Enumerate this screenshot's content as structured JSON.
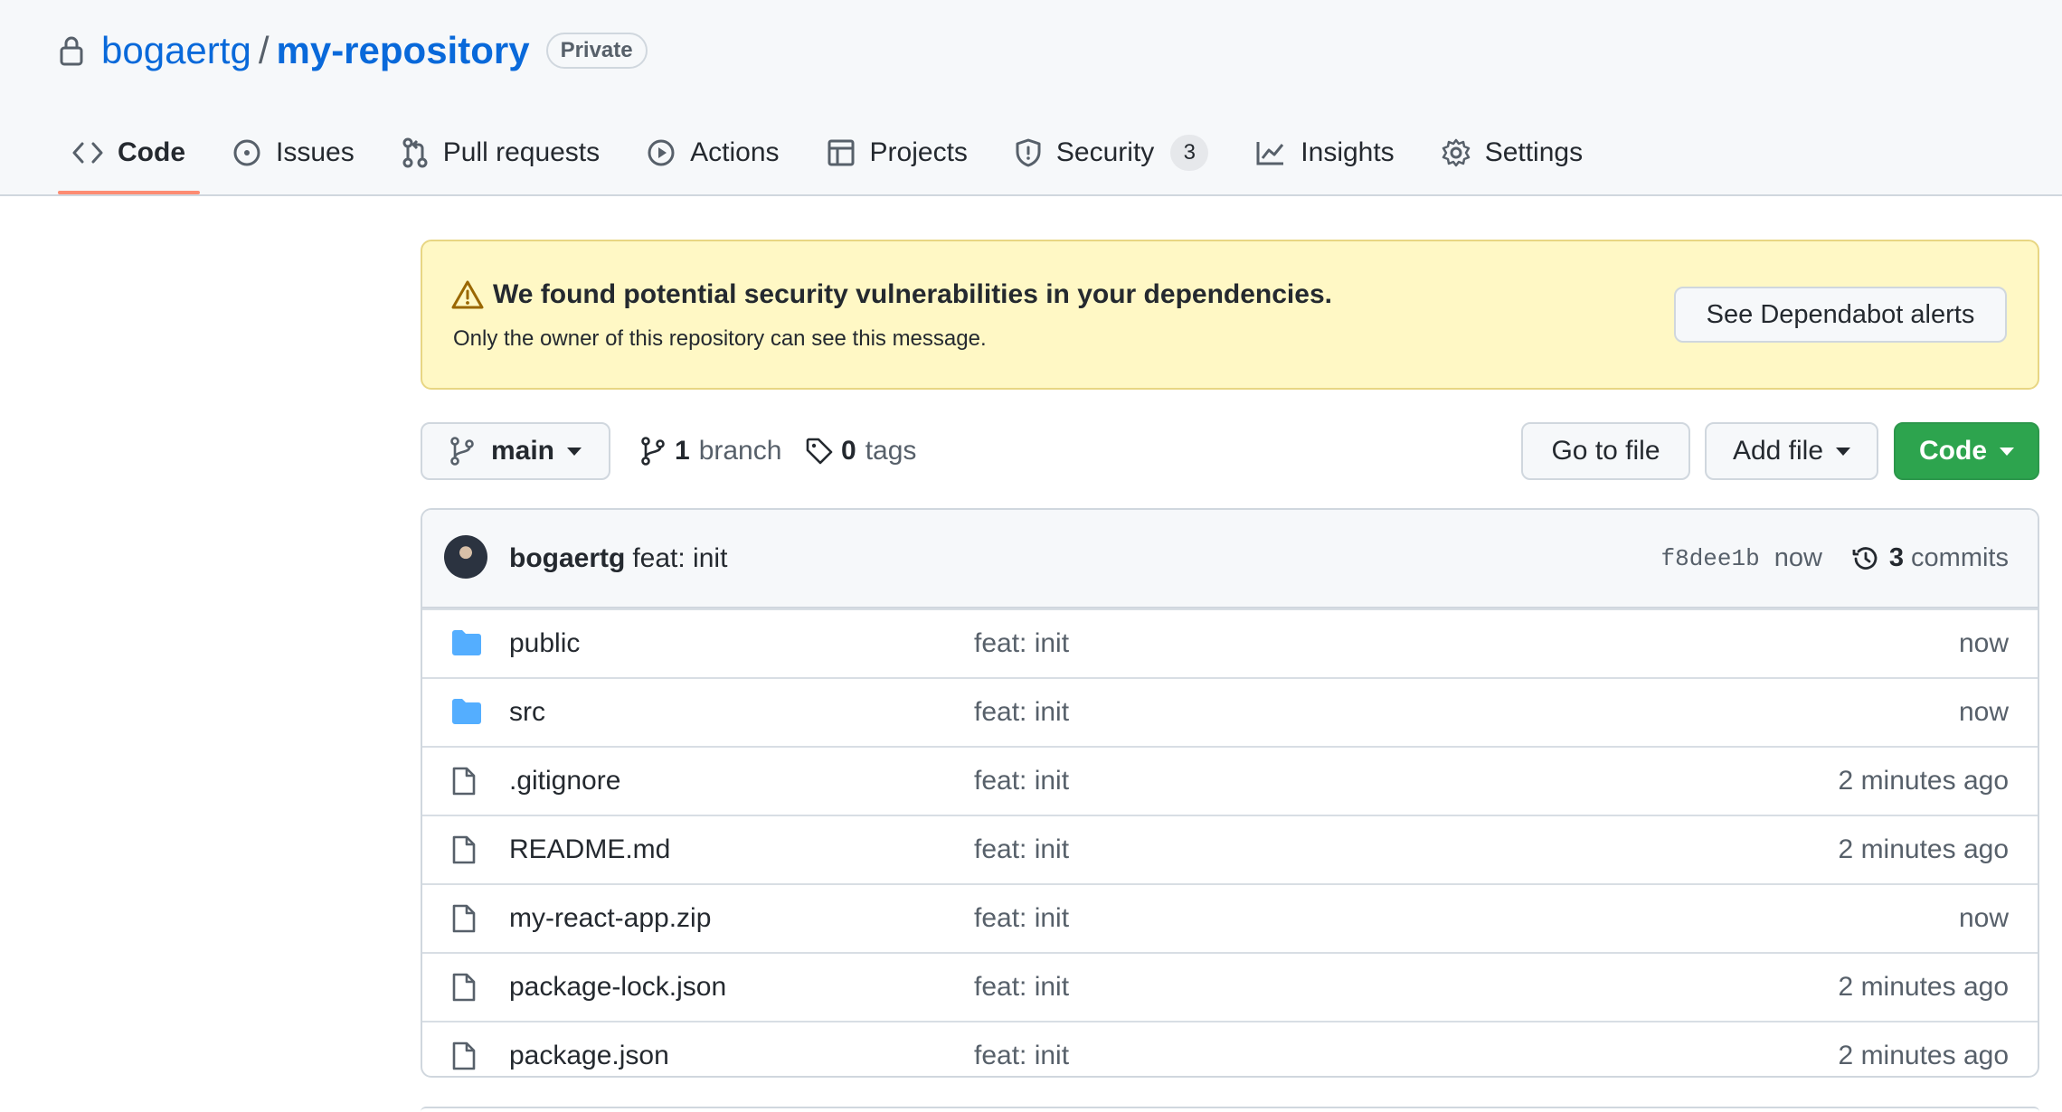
{
  "repo": {
    "owner": "bogaertg",
    "separator": "/",
    "name": "my-repository",
    "visibility": "Private"
  },
  "tabs": [
    {
      "label": "Code",
      "icon": "code-icon",
      "active": true
    },
    {
      "label": "Issues",
      "icon": "issue-icon"
    },
    {
      "label": "Pull requests",
      "icon": "pull-request-icon"
    },
    {
      "label": "Actions",
      "icon": "play-icon"
    },
    {
      "label": "Projects",
      "icon": "table-icon"
    },
    {
      "label": "Security",
      "icon": "shield-icon",
      "count": "3"
    },
    {
      "label": "Insights",
      "icon": "graph-icon"
    },
    {
      "label": "Settings",
      "icon": "gear-icon"
    }
  ],
  "banner": {
    "title": "We found potential security vulnerabilities in your dependencies.",
    "subtitle": "Only the owner of this repository can see this message.",
    "button": "See Dependabot alerts"
  },
  "branchbar": {
    "branch": "main",
    "branch_count": "1",
    "branch_label": "branch",
    "tag_count": "0",
    "tag_label": "tags",
    "go_to_file": "Go to file",
    "add_file": "Add file",
    "code": "Code"
  },
  "commit": {
    "author": "bogaertg",
    "message": "feat: init",
    "sha": "f8dee1b",
    "time": "now",
    "count": "3",
    "count_label": "commits"
  },
  "files": [
    {
      "name": "public",
      "type": "folder",
      "message": "feat: init",
      "age": "now"
    },
    {
      "name": "src",
      "type": "folder",
      "message": "feat: init",
      "age": "now"
    },
    {
      "name": ".gitignore",
      "type": "file",
      "message": "feat: init",
      "age": "2 minutes ago"
    },
    {
      "name": "README.md",
      "type": "file",
      "message": "feat: init",
      "age": "2 minutes ago"
    },
    {
      "name": "my-react-app.zip",
      "type": "file",
      "message": "feat: init",
      "age": "now"
    },
    {
      "name": "package-lock.json",
      "type": "file",
      "message": "feat: init",
      "age": "2 minutes ago"
    },
    {
      "name": "package.json",
      "type": "file",
      "message": "feat: init",
      "age": "2 minutes ago"
    }
  ],
  "colors": {
    "link": "#0969da",
    "accent_tab": "#fd8c73",
    "banner_bg": "#fff8c5",
    "code_button": "#2da44e",
    "folder": "#54aeff"
  }
}
